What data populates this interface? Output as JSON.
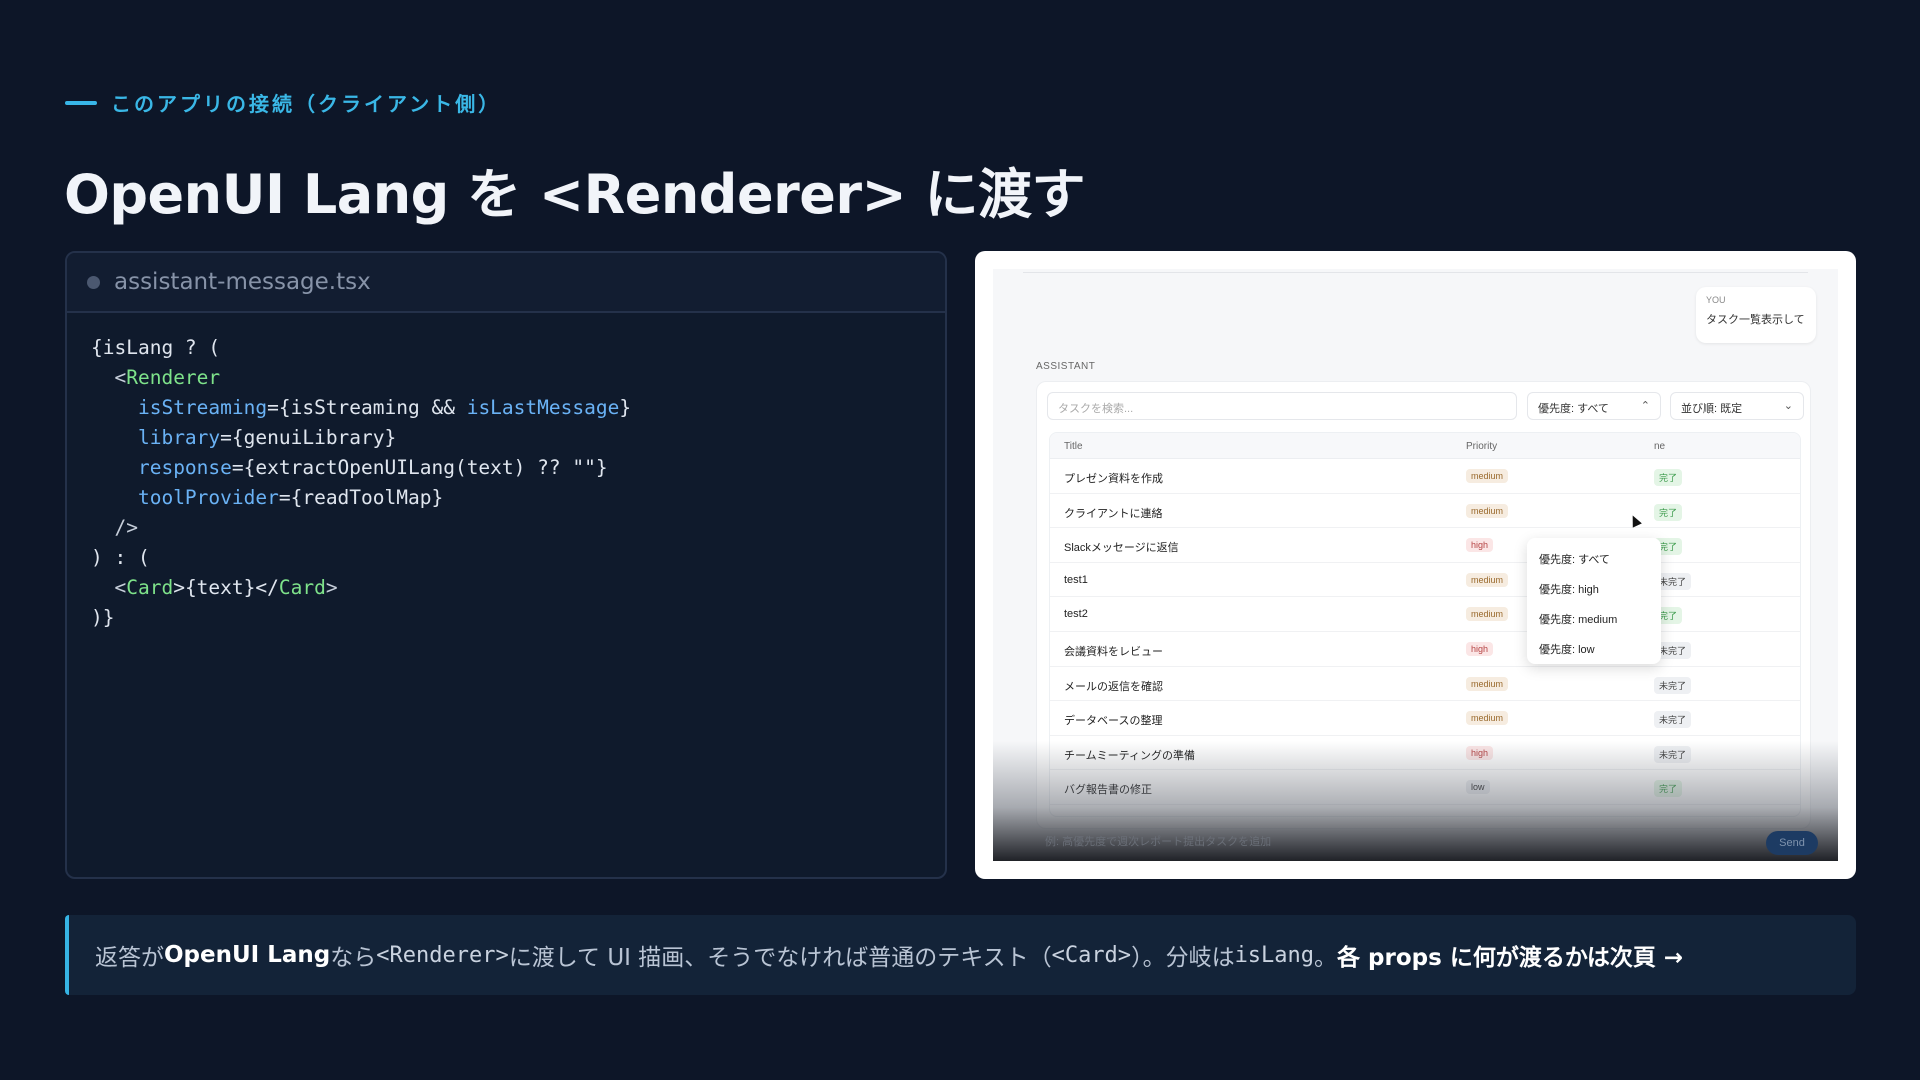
{
  "eyebrow": "このアプリの接続（クライアント側）",
  "title": "OpenUI Lang を <Renderer> に渡す",
  "code_panel": {
    "filename": "assistant-message.tsx",
    "lines": [
      [
        {
          "t": "{isLang ? (",
          "c": "plain"
        }
      ],
      [
        {
          "t": "  <",
          "c": "punc"
        },
        {
          "t": "Renderer",
          "c": "tag"
        }
      ],
      [
        {
          "t": "    ",
          "c": "plain"
        },
        {
          "t": "isStreaming",
          "c": "attr"
        },
        {
          "t": "={isStreaming && ",
          "c": "plain"
        },
        {
          "t": "isLastMessage",
          "c": "attr"
        },
        {
          "t": "}",
          "c": "plain"
        }
      ],
      [
        {
          "t": "    ",
          "c": "plain"
        },
        {
          "t": "library",
          "c": "attr"
        },
        {
          "t": "={genuiLibrary}",
          "c": "plain"
        }
      ],
      [
        {
          "t": "    ",
          "c": "plain"
        },
        {
          "t": "response",
          "c": "attr"
        },
        {
          "t": "={extractOpenUILang(text) ?? \"\"}",
          "c": "plain"
        }
      ],
      [
        {
          "t": "    ",
          "c": "plain"
        },
        {
          "t": "toolProvider",
          "c": "attr"
        },
        {
          "t": "={readToolMap}",
          "c": "plain"
        }
      ],
      [
        {
          "t": "  />",
          "c": "punc"
        }
      ],
      [
        {
          "t": ") : (",
          "c": "plain"
        }
      ],
      [
        {
          "t": "  <",
          "c": "punc"
        },
        {
          "t": "Card",
          "c": "tag"
        },
        {
          "t": ">{text}</",
          "c": "plain"
        },
        {
          "t": "Card",
          "c": "tag"
        },
        {
          "t": ">",
          "c": "punc"
        }
      ],
      [
        {
          "t": ")}",
          "c": "plain"
        }
      ]
    ]
  },
  "screenshot": {
    "you_label": "YOU",
    "you_text": "タスク一覧表示して",
    "assistant_label": "ASSISTANT",
    "search_placeholder": "タスクを検索...",
    "priority_select": "優先度: すべて",
    "sort_select": "並び順: 既定",
    "columns": [
      "Title",
      "Priority",
      "ne"
    ],
    "rows": [
      {
        "title": "プレゼン資料を作成",
        "priority": "medium",
        "status": "完了"
      },
      {
        "title": "クライアントに連絡",
        "priority": "medium",
        "status": "完了"
      },
      {
        "title": "Slackメッセージに返信",
        "priority": "high",
        "status": "完了"
      },
      {
        "title": "test1",
        "priority": "medium",
        "status": "未完了"
      },
      {
        "title": "test2",
        "priority": "medium",
        "status": "完了"
      },
      {
        "title": "会議資料をレビュー",
        "priority": "high",
        "status": "未完了"
      },
      {
        "title": "メールの返信を確認",
        "priority": "medium",
        "status": "未完了"
      },
      {
        "title": "データベースの整理",
        "priority": "medium",
        "status": "未完了"
      },
      {
        "title": "チームミーティングの準備",
        "priority": "high",
        "status": "未完了"
      },
      {
        "title": "バグ報告書の修正",
        "priority": "low",
        "status": "完了"
      }
    ],
    "dropdown_options": [
      "優先度: すべて",
      "優先度: high",
      "優先度: medium",
      "優先度: low"
    ],
    "compose_placeholder": "例: 高優先度で週次レポート提出タスクを追加",
    "send_label": "Send"
  },
  "note": {
    "p1": "返答が ",
    "b1": "OpenUI Lang",
    "p2": " なら ",
    "m1": "<Renderer>",
    "p3": " に渡して UI 描画、そうでなければ普通のテキスト（",
    "m2": "<Card>",
    "p4": "）。分岐は ",
    "m3": "isLang",
    "p5": "。",
    "b2": "各 props に何が渡るかは次頁 →"
  },
  "colors": {
    "background": "#0d1628",
    "accent": "#38b6e8",
    "code_tag": "#7ee28a",
    "code_attr": "#6ab2f5"
  }
}
